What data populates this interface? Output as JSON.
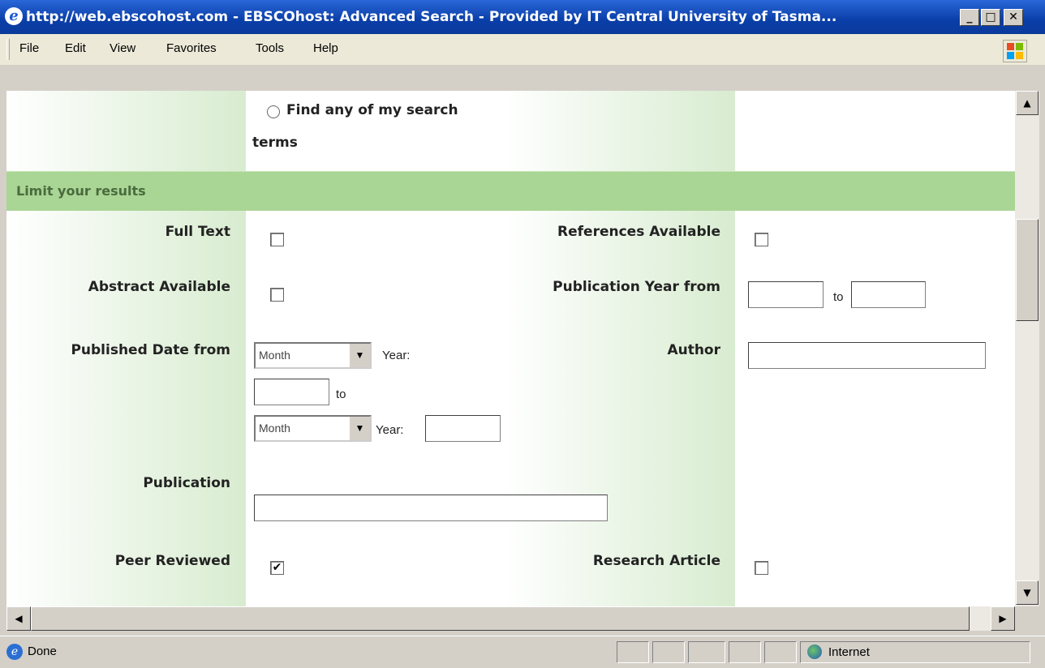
{
  "window": {
    "title": "http://web.ebscohost.com - EBSCOhost: Advanced Search - Provided by IT Central University of Tasma...",
    "minimize": "_",
    "maximize": "□",
    "close": "✕"
  },
  "menu": [
    "File",
    "Edit",
    "View",
    "Favorites",
    "Tools",
    "Help"
  ],
  "search_mode": {
    "option_line1": "Find any of my search",
    "option_line2": "terms"
  },
  "limits": {
    "header": "Limit your results",
    "full_text": "Full Text",
    "references_available": "References Available",
    "abstract_available": "Abstract Available",
    "publication_year_from": "Publication Year from",
    "year_to": "to",
    "published_date_from": "Published Date from",
    "month_label": "Month",
    "year_label": "Year:",
    "date_to": "to",
    "author": "Author",
    "publication": "Publication",
    "peer_reviewed": "Peer Reviewed",
    "peer_reviewed_checked": "✔",
    "research_article": "Research Article"
  },
  "scroll": {
    "up": "▲",
    "down": "▼",
    "left": "◀",
    "right": "▶"
  },
  "status": {
    "text": "Done",
    "zone": "Internet"
  }
}
